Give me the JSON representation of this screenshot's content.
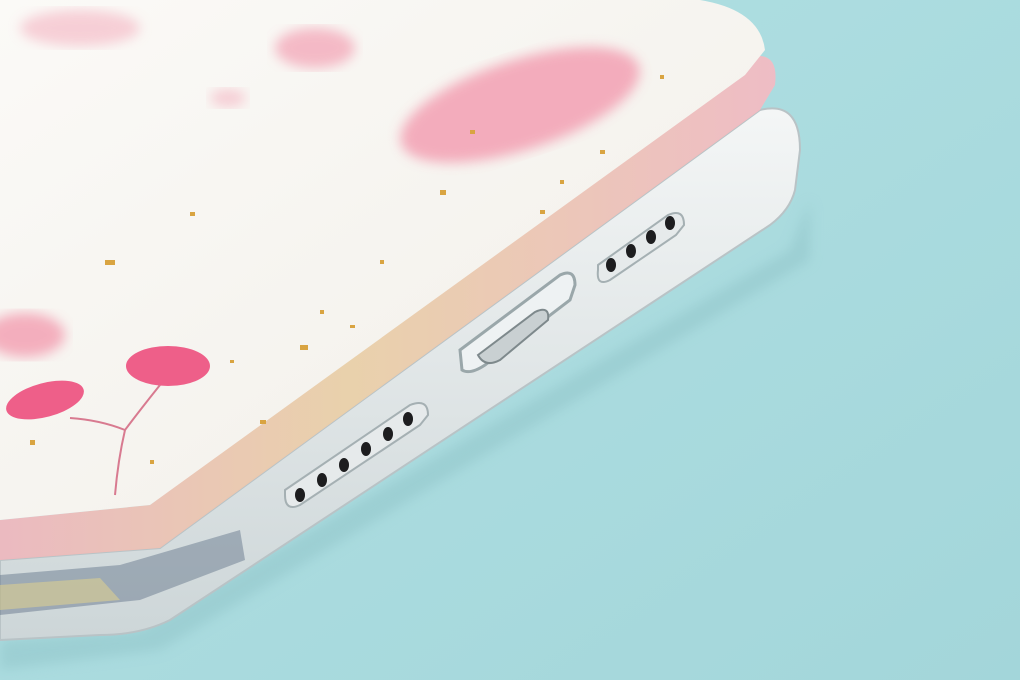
{
  "colors": {
    "background": "#a9dcdf",
    "case_face": "#f7f5f0",
    "flower_pink": "#f07a9c",
    "flower_light": "#f4a6b8",
    "gold_flake": "#d9a441",
    "edge_band": "#e9c7a8",
    "frame_side": "#dfe4e6",
    "speaker_hole": "#1d1d1f"
  },
  "speaker_holes": {
    "left_group": 6,
    "right_group": 4
  }
}
